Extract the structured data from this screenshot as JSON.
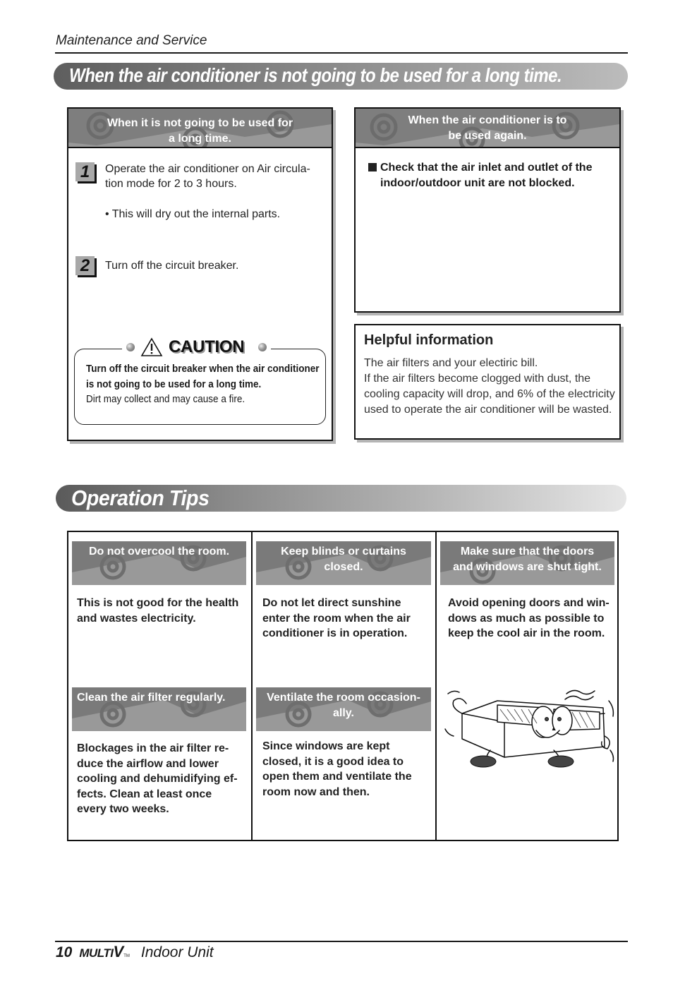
{
  "header": {
    "running_title": "Maintenance and Service"
  },
  "section1": {
    "banner_title": "When the air conditioner is not going to be used for a long time.",
    "left_box": {
      "header_line1": "When it is not going to be used for",
      "header_line2": "a long time.",
      "steps": [
        {
          "number": "1",
          "text": "Operate the air conditioner on Air circula-tion mode for 2 to 3 hours.",
          "note": "• This will dry out the internal parts."
        },
        {
          "number": "2",
          "text": "Turn off the circuit breaker."
        }
      ],
      "caution": {
        "label": "CAUTION",
        "bold_line1": "Turn off the circuit breaker when the air conditioner",
        "bold_line2": "is not going to be used for a long time.",
        "plain": "Dirt may collect and may cause a fire."
      }
    },
    "right_box": {
      "header_line1": "When the air conditioner is to",
      "header_line2": "be used again.",
      "item_line1": "Check that the air inlet and outlet of the",
      "item_line2": "indoor/outdoor unit are not blocked."
    },
    "helpful_info": {
      "title": "Helpful information",
      "lines": [
        "The air filters and your electiric bill.",
        "If the air filters become clogged with dust, the",
        "cooling capacity will drop, and 6% of the electricity",
        "used to operate the air conditioner will be wasted."
      ]
    }
  },
  "section2": {
    "banner_title": "Operation Tips",
    "tips": [
      {
        "title_line1": "Do not overcool the room.",
        "title_line2": "",
        "body": [
          "This is not good for the health",
          "and wastes electricity."
        ]
      },
      {
        "title_line1": "Keep blinds or curtains",
        "title_line2": "closed.",
        "body": [
          "Do not let direct sunshine",
          "enter the room when the air",
          "conditioner is in operation."
        ]
      },
      {
        "title_line1": "Make sure that the doors",
        "title_line2": "and windows are shut tight.",
        "body": [
          "Avoid opening doors and win-",
          "dows as much as possible to",
          "keep the cool air in the room."
        ]
      },
      {
        "title_line1": "Clean the air filter regularly.",
        "title_line2": "",
        "body": [
          "Blockages in the air filter re-",
          "duce the airflow and lower",
          "cooling and dehumidifying ef-",
          "fects. Clean at least once",
          "every two weeks."
        ]
      },
      {
        "title_line1": "Ventilate the room occasion-",
        "title_line2": "ally.",
        "body": [
          "Since windows are kept",
          "closed, it is a good idea to",
          "open them and ventilate the",
          "room now and then."
        ]
      }
    ],
    "illustration": "cartoon-indoor-unit"
  },
  "footer": {
    "page_number": "10",
    "brand": "MULTI",
    "brand_v": "V",
    "brand_tm": "TM",
    "title": "Indoor Unit"
  }
}
